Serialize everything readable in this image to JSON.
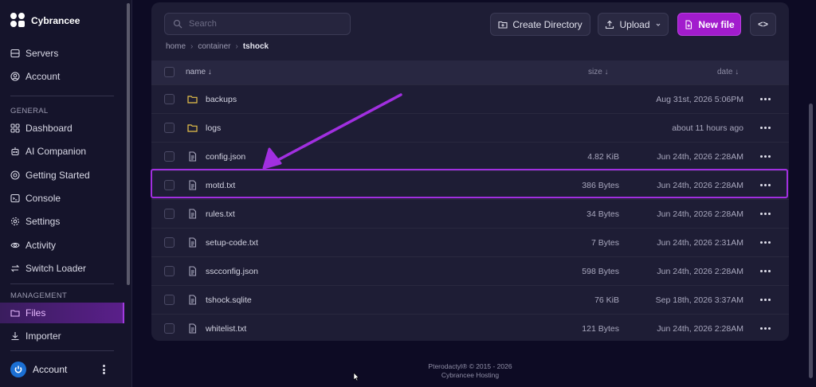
{
  "brand": {
    "name": "Cybrancee"
  },
  "sidebar": {
    "top_items": [
      {
        "label": "Servers",
        "icon": "server-icon"
      },
      {
        "label": "Account",
        "icon": "user-circle-icon"
      }
    ],
    "general_title": "GENERAL",
    "general_items": [
      {
        "label": "Dashboard",
        "icon": "grid-icon"
      },
      {
        "label": "AI Companion",
        "icon": "robot-icon"
      },
      {
        "label": "Getting Started",
        "icon": "lifebuoy-icon"
      },
      {
        "label": "Console",
        "icon": "terminal-icon"
      },
      {
        "label": "Settings",
        "icon": "gear-icon"
      },
      {
        "label": "Activity",
        "icon": "eye-icon"
      },
      {
        "label": "Switch Loader",
        "icon": "switch-icon"
      }
    ],
    "management_title": "MANAGEMENT",
    "management_items": [
      {
        "label": "Files",
        "icon": "folder-open-icon",
        "active": true
      },
      {
        "label": "Importer",
        "icon": "download-icon"
      }
    ],
    "account_bottom": {
      "label": "Account"
    }
  },
  "toolbar": {
    "search_placeholder": "Search",
    "create_directory_label": "Create Directory",
    "upload_label": "Upload",
    "new_file_label": "New file",
    "code_label": "<>"
  },
  "breadcrumb": [
    "home",
    "container",
    "tshock"
  ],
  "table": {
    "columns": {
      "name": "name ↓",
      "size": "size ↓",
      "date": "date ↓"
    },
    "rows": [
      {
        "type": "folder",
        "name": "backups",
        "size": "",
        "date": "Aug 31st, 2026 5:06PM"
      },
      {
        "type": "folder",
        "name": "logs",
        "size": "",
        "date": "about 11 hours ago"
      },
      {
        "type": "file",
        "name": "config.json",
        "size": "4.82 KiB",
        "date": "Jun 24th, 2026 2:28AM"
      },
      {
        "type": "file",
        "name": "motd.txt",
        "size": "386 Bytes",
        "date": "Jun 24th, 2026 2:28AM"
      },
      {
        "type": "file",
        "name": "rules.txt",
        "size": "34 Bytes",
        "date": "Jun 24th, 2026 2:28AM"
      },
      {
        "type": "file",
        "name": "setup-code.txt",
        "size": "7 Bytes",
        "date": "Jun 24th, 2026 2:31AM"
      },
      {
        "type": "file",
        "name": "sscconfig.json",
        "size": "598 Bytes",
        "date": "Jun 24th, 2026 2:28AM"
      },
      {
        "type": "file",
        "name": "tshock.sqlite",
        "size": "76 KiB",
        "date": "Sep 18th, 2026 3:37AM"
      },
      {
        "type": "file",
        "name": "whitelist.txt",
        "size": "121 Bytes",
        "date": "Jun 24th, 2026 2:28AM"
      }
    ]
  },
  "footer": {
    "line1": "Pterodactyl® © 2015 - 2026",
    "line2": "Cybrancee Hosting"
  },
  "colors": {
    "accent": "#a21ccd",
    "highlight": "#a12fe0",
    "folder": "#e8c34a"
  }
}
